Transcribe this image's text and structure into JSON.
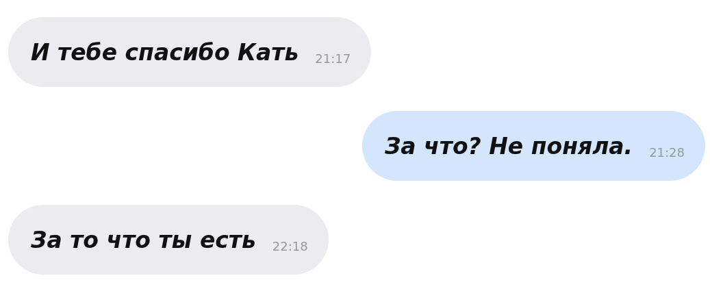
{
  "messages": [
    {
      "text": "И тебе спасибо Кать",
      "time": "21:17",
      "kind": "incoming"
    },
    {
      "text": "За что? Не поняла.",
      "time": "21:28",
      "kind": "outgoing"
    },
    {
      "text": "За то что ты есть",
      "time": "22:18",
      "kind": "incoming"
    }
  ]
}
